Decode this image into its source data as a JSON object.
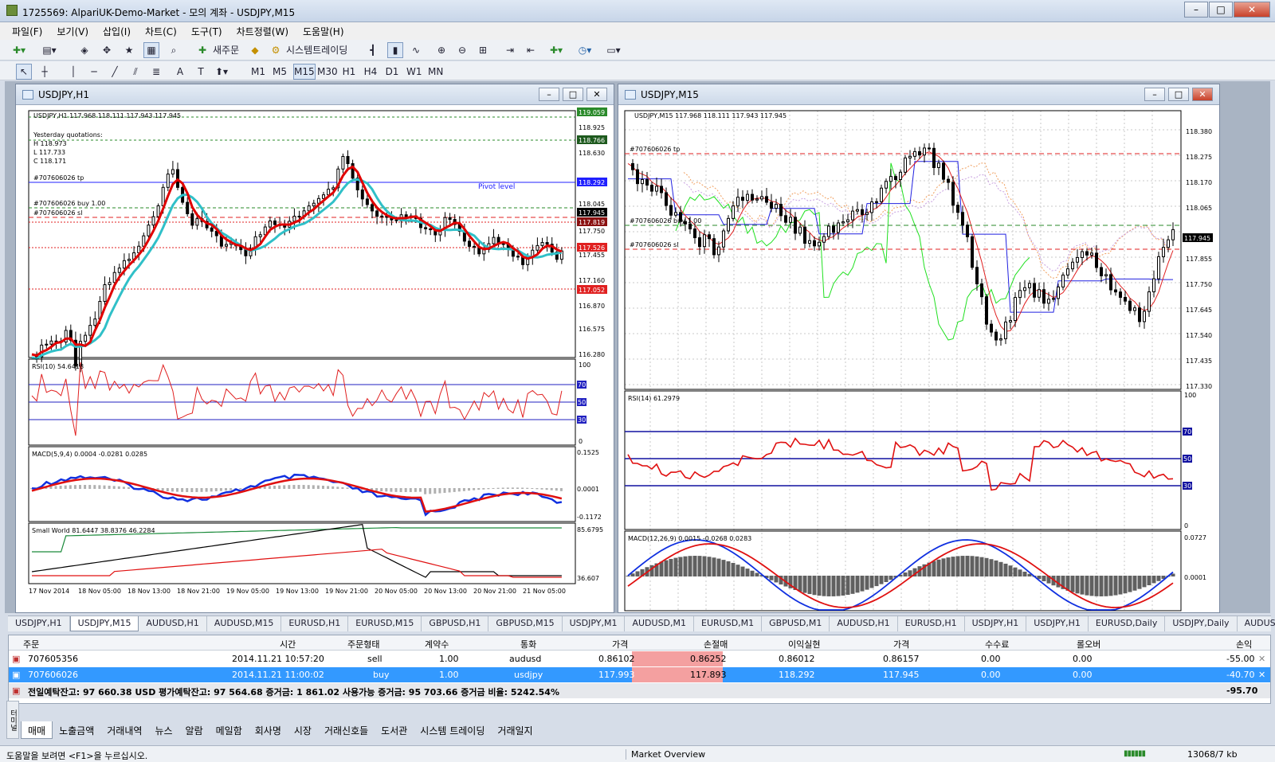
{
  "window": {
    "title": "1725569: AlpariUK-Demo-Market - 모의 계좌 - USDJPY,M15"
  },
  "menu": [
    "파일(F)",
    "보기(V)",
    "삽입(I)",
    "차트(C)",
    "도구(T)",
    "차트정렬(W)",
    "도움말(H)"
  ],
  "toolbar": {
    "new_order": "새주문",
    "auto_trading": "시스템트레이딩",
    "timeframes": [
      "M1",
      "M5",
      "M15",
      "M30",
      "H1",
      "H4",
      "D1",
      "W1",
      "MN"
    ],
    "active_timeframe": "M15"
  },
  "chart_left": {
    "title": "USDJPY,H1",
    "header": "USDJPY,H1  117.968 118.111 117.943 117.945",
    "yesterday": [
      "Yesterday quotations:",
      "H 118.973",
      "L 117.733",
      "C 118.171"
    ],
    "order_labels": [
      "#707606026 tp",
      "#707606026 buy 1.00",
      "#707606026 sl"
    ],
    "pivot_label": "Pivot level",
    "price_scale": [
      "119.059",
      "118.925",
      "118.766",
      "118.630",
      "118.292",
      "118.045",
      "117.945",
      "117.819",
      "117.750",
      "117.526",
      "117.455",
      "117.160",
      "117.052",
      "116.870",
      "116.575",
      "116.280"
    ],
    "rsi_label": "RSI(10) 54.6418",
    "rsi_scale": [
      "100",
      "70",
      "50",
      "30",
      "0"
    ],
    "macd_label": "MACD(5,9,4) 0.0004 -0.0281 0.0285",
    "macd_scale": [
      "0.1525",
      "0.0001",
      "-0.1172"
    ],
    "sw_label": "Small World 81.6447 38.8376 46.2284",
    "sw_scale": [
      "85.6795",
      "36.607"
    ],
    "time_axis": [
      "17 Nov 2014",
      "18 Nov 05:00",
      "18 Nov 13:00",
      "18 Nov 21:00",
      "19 Nov 05:00",
      "19 Nov 13:00",
      "19 Nov 21:00",
      "20 Nov 05:00",
      "20 Nov 13:00",
      "20 Nov 21:00",
      "21 Nov 05:00"
    ]
  },
  "chart_right": {
    "title": "USDJPY,M15",
    "header": "USDJPY,M15  117.968 118.111 117.943 117.945",
    "order_labels": [
      "#707606026 tp",
      "#707606026 buy 1.00",
      "#707606026 sl"
    ],
    "price_scale": [
      "118.380",
      "118.275",
      "118.170",
      "118.065",
      "117.945",
      "117.855",
      "117.750",
      "117.645",
      "117.540",
      "117.435",
      "117.330"
    ],
    "rsi_label": "RSI(14) 61.2979",
    "rsi_scale": [
      "100",
      "70",
      "50",
      "30",
      "0"
    ],
    "macd_label": "MACD(12,26,9) 0.0015 -0.0268 0.0283",
    "macd_scale": [
      "0.0727",
      "0.0001"
    ]
  },
  "symbol_tabs": [
    "USDJPY,H1",
    "USDJPY,M15",
    "AUDUSD,H1",
    "AUDUSD,M15",
    "EURUSD,H1",
    "EURUSD,M15",
    "GBPUSD,H1",
    "GBPUSD,M15",
    "USDJPY,M1",
    "AUDUSD,M1",
    "EURUSD,M1",
    "GBPUSD,M1",
    "AUDUSD,H1",
    "EURUSD,H1",
    "USDJPY,H1",
    "USDJPY,H1",
    "EURUSD,Daily",
    "USDJPY,Daily",
    "AUDUSD,Daily"
  ],
  "active_symbol_tab": "USDJPY,M15",
  "terminal": {
    "columns": [
      "주문",
      "시간",
      "주문형태",
      "계약수",
      "통화",
      "가격",
      "손절매",
      "이익실현",
      "가격",
      "수수료",
      "롤오버",
      "손익"
    ],
    "rows": [
      [
        "707605356",
        "2014.11.21 10:57:20",
        "sell",
        "1.00",
        "audusd",
        "0.86102",
        "0.86252",
        "0.86012",
        "0.86157",
        "0.00",
        "0.00",
        "-55.00"
      ],
      [
        "707606026",
        "2014.11.21 11:00:02",
        "buy",
        "1.00",
        "usdjpy",
        "117.993",
        "117.893",
        "118.292",
        "117.945",
        "0.00",
        "0.00",
        "-40.70"
      ]
    ],
    "summary": "전일예탁잔고: 97 660.38 USD  평가예탁잔고: 97 564.68  증거금: 1 861.02  사용가능 증거금: 95 703.66  증거금 비율: 5242.54%",
    "total": "-95.70",
    "tabs": [
      "매매",
      "노출금액",
      "거래내역",
      "뉴스",
      "알람",
      "메일함",
      "회사명",
      "시장",
      "거래신호들",
      "도서관",
      "시스템 트레이딩",
      "거래일지"
    ],
    "side_label": "터미널"
  },
  "status": {
    "help": "도움말을 보려면 <F1>을 누르십시오.",
    "market": "Market Overview",
    "traffic": "13068/7 kb"
  }
}
